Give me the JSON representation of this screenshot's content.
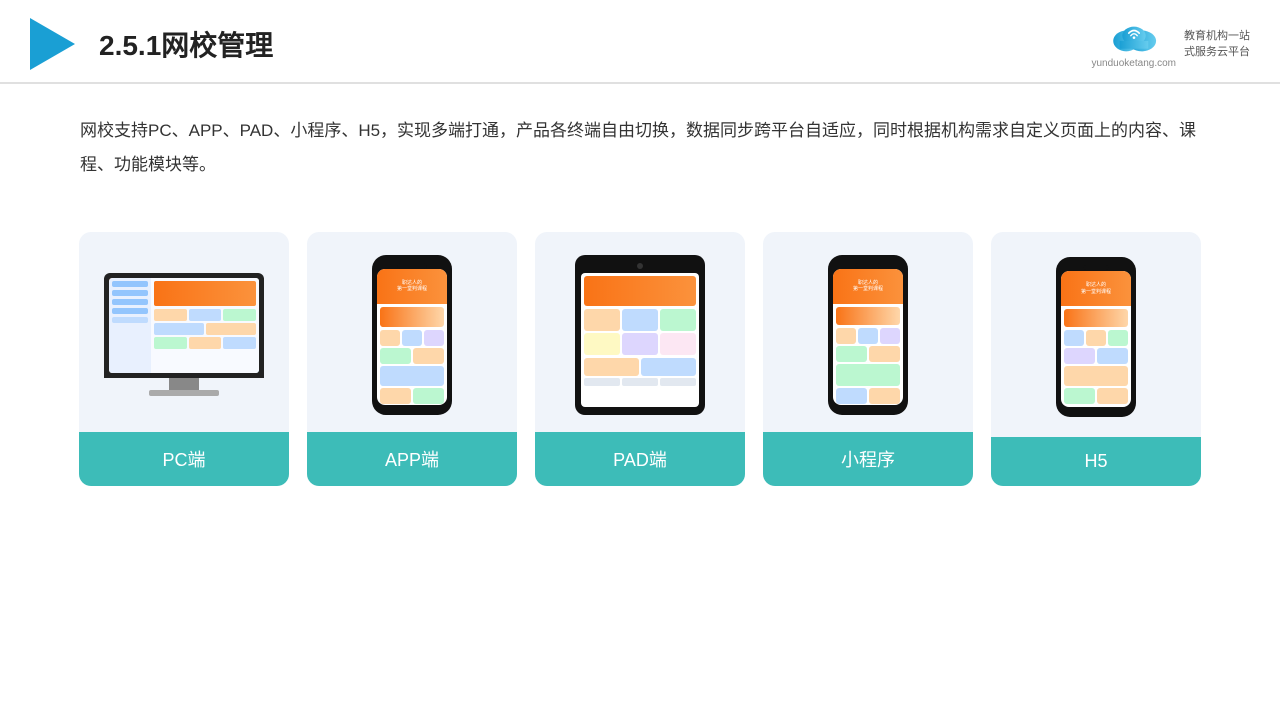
{
  "header": {
    "title": "2.5.1网校管理",
    "brand_name": "yunduoketang.com",
    "brand_slogan": "教育机构一站\n式服务云平台"
  },
  "description": "网校支持PC、APP、PAD、小程序、H5，实现多端打通，产品各终端自由切换，数据同步跨平台自适应，同时根据机构需求自定义页面上的内容、课程、功能模块等。",
  "cards": [
    {
      "id": "pc",
      "label": "PC端"
    },
    {
      "id": "app",
      "label": "APP端"
    },
    {
      "id": "pad",
      "label": "PAD端"
    },
    {
      "id": "miniprogram",
      "label": "小程序"
    },
    {
      "id": "h5",
      "label": "H5"
    }
  ],
  "colors": {
    "accent": "#3dbcb8",
    "header_border": "#e0e0e0",
    "card_bg": "#f0f4fa",
    "title_color": "#222222"
  }
}
